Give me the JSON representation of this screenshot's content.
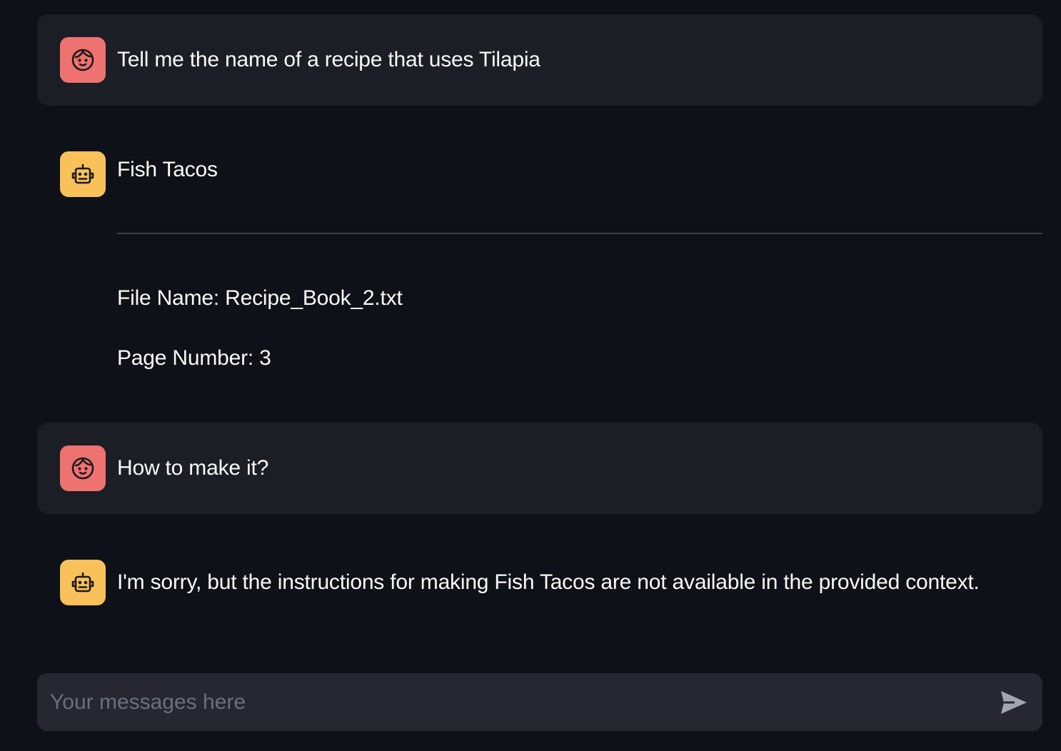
{
  "messages": [
    {
      "role": "user",
      "avatar_icon": "user-face-icon",
      "text": "Tell me the name of a recipe that uses Tilapia"
    },
    {
      "role": "assistant",
      "avatar_icon": "robot-icon",
      "text": "Fish Tacos",
      "file_line": "File Name: Recipe_Book_2.txt",
      "page_line": "Page Number: 3"
    },
    {
      "role": "user",
      "avatar_icon": "user-face-icon",
      "text": "How to make it?"
    },
    {
      "role": "assistant",
      "avatar_icon": "robot-icon",
      "text": "I'm sorry, but the instructions for making Fish Tacos are not available in the provided context."
    }
  ],
  "chat_input": {
    "placeholder": "Your messages here",
    "value": "",
    "send_icon": "send-arrow-icon"
  },
  "colors": {
    "background": "#0e1117",
    "user_message_bg": "#1c1e26",
    "user_avatar": "#ee7270",
    "assistant_avatar": "#f9c15a",
    "input_bg": "#262730",
    "text": "#fafafa",
    "placeholder": "#6c6f7a"
  }
}
